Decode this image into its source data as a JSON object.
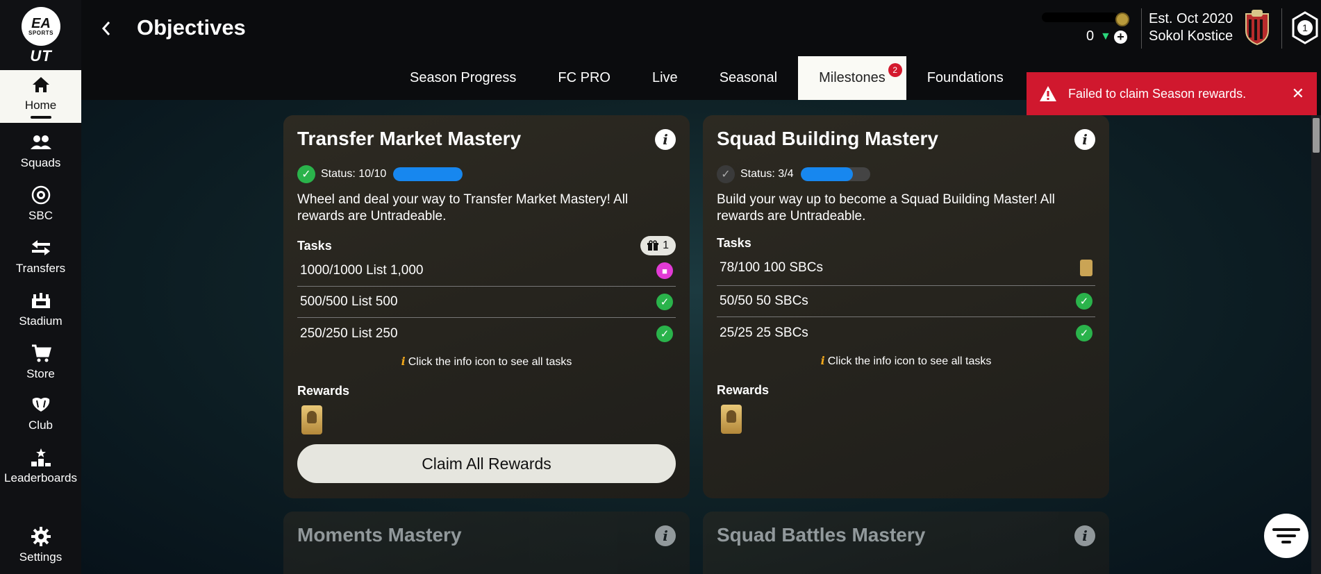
{
  "app": {
    "logo_ea": "EA",
    "logo_sports": "SPORTS",
    "logo_ut": "UT"
  },
  "header": {
    "title": "Objectives",
    "points": "0",
    "club_est": "Est. Oct 2020",
    "club_name": "Sokol Kostice"
  },
  "sidebar": {
    "items": [
      {
        "label": "Home",
        "icon": "home-icon"
      },
      {
        "label": "Squads",
        "icon": "squads-icon"
      },
      {
        "label": "SBC",
        "icon": "sbc-icon"
      },
      {
        "label": "Transfers",
        "icon": "transfers-icon"
      },
      {
        "label": "Stadium",
        "icon": "stadium-icon"
      },
      {
        "label": "Store",
        "icon": "cart-icon"
      },
      {
        "label": "Club",
        "icon": "club-icon"
      },
      {
        "label": "Leaderboards",
        "icon": "leaderboards-icon"
      },
      {
        "label": "Settings",
        "icon": "gear-icon"
      }
    ]
  },
  "tabs": [
    {
      "label": "Season Progress"
    },
    {
      "label": "FC PRO"
    },
    {
      "label": "Live"
    },
    {
      "label": "Seasonal"
    },
    {
      "label": "Milestones",
      "badge": "2"
    },
    {
      "label": "Foundations"
    }
  ],
  "toast": {
    "message": "Failed to claim Season rewards."
  },
  "cards": [
    {
      "title": "Transfer Market Mastery",
      "status": "Status: 10/10",
      "progress": 1.0,
      "description": "Wheel and deal your way to Transfer Market Mastery! All rewards are Untradeable.",
      "tasks_label": "Tasks",
      "gift_count": "1",
      "tasks": [
        {
          "text": "1000/1000  List 1,000"
        },
        {
          "text": "500/500  List 500"
        },
        {
          "text": "250/250  List 250"
        }
      ],
      "hint": "Click the info icon to see all tasks",
      "rewards_label": "Rewards",
      "claim_label": "Claim All Rewards"
    },
    {
      "title": "Squad Building Mastery",
      "status": "Status: 3/4",
      "progress": 0.75,
      "description": "Build your way up to become a Squad Building Master! All rewards are Untradeable.",
      "tasks_label": "Tasks",
      "tasks": [
        {
          "text": "78/100  100 SBCs"
        },
        {
          "text": "50/50  50 SBCs"
        },
        {
          "text": "25/25  25 SBCs"
        }
      ],
      "hint": "Click the info icon to see all tasks",
      "rewards_label": "Rewards"
    },
    {
      "title": "Moments Mastery"
    },
    {
      "title": "Squad Battles Mastery"
    }
  ],
  "colors": {
    "accent_blue": "#1787ef",
    "toast_red": "#d0182e",
    "check_green": "#2ab34b"
  }
}
